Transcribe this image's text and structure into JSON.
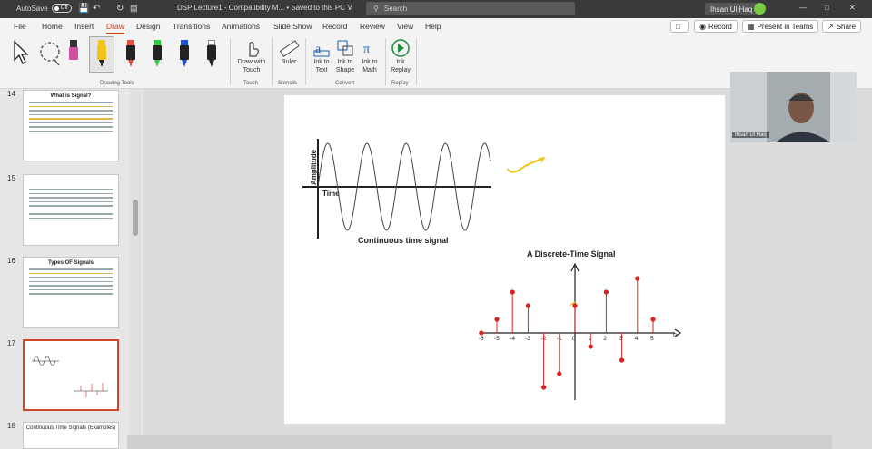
{
  "titlebar": {
    "autosave": "AutoSave",
    "autosave_state": "Off",
    "doc_title": "DSP Lecture1 - Compatibility M... • Saved to this PC ∨",
    "search_placeholder": "Search",
    "user": "Ihsan Ul Haq",
    "window_controls": [
      "—",
      "□",
      "✕"
    ]
  },
  "menu": {
    "items": [
      "File",
      "Home",
      "Insert",
      "Draw",
      "Design",
      "Transitions",
      "Animations",
      "Slide Show",
      "Record",
      "Review",
      "View",
      "Help"
    ],
    "active": "Draw",
    "record_btn": "Record",
    "teams_btn": "Present in Teams",
    "share_btn": "Share"
  },
  "ribbon": {
    "groups": {
      "drawing_tools": "Drawing Tools",
      "touch": "Touch",
      "stencils": "Stencils",
      "convert": "Convert",
      "replay": "Replay"
    },
    "buttons": {
      "draw_with_touch": "Draw with Touch",
      "ruler": "Ruler",
      "ink_to_text": "Ink to Text",
      "ink_to_shape": "Ink to Shape",
      "ink_to_math": "Ink to Math",
      "ink_replay": "Ink Replay"
    },
    "pen_colors": [
      "#f0c419",
      "#e84c3d",
      "#f08a1a",
      "#2ecc40",
      "#1a4fd8",
      "#ffffff"
    ]
  },
  "thumbnails": [
    {
      "num": "14",
      "title": "What is Signal?"
    },
    {
      "num": "15",
      "title": ""
    },
    {
      "num": "16",
      "title": "Types OF Signals"
    },
    {
      "num": "17",
      "title": ""
    },
    {
      "num": "18",
      "title": "Continuous Time Signals (Examples)"
    }
  ],
  "slide": {
    "continuous_axis_y": "Amplitude",
    "continuous_axis_x": "Time",
    "continuous_caption": "Continuous time signal",
    "discrete_title": "A Discrete-Time Signal",
    "discrete_axis_n": "n"
  },
  "chart_data": [
    {
      "type": "line",
      "title": "Continuous time signal",
      "xlabel": "Time",
      "ylabel": "Amplitude",
      "series": [
        {
          "values": "sinusoid"
        }
      ]
    },
    {
      "type": "scatter",
      "title": "A Discrete-Time Signal",
      "xlabel": "n",
      "x": [
        -6,
        -5,
        -4,
        -3,
        -2,
        -1,
        0,
        1,
        2,
        3,
        4,
        5
      ],
      "y": [
        0,
        1,
        3,
        2,
        -4,
        -3,
        2,
        -1,
        3,
        -2,
        4,
        1
      ],
      "ticks": [
        "-6",
        "-5",
        "-4",
        "-3",
        "-2",
        "-1",
        "0",
        "1",
        "2",
        "3",
        "4",
        "5"
      ],
      "colors": {
        "stem": "#d9231f",
        "axis": "#222222"
      }
    }
  ],
  "video": {
    "name": "Ihsan Ul Haq"
  }
}
